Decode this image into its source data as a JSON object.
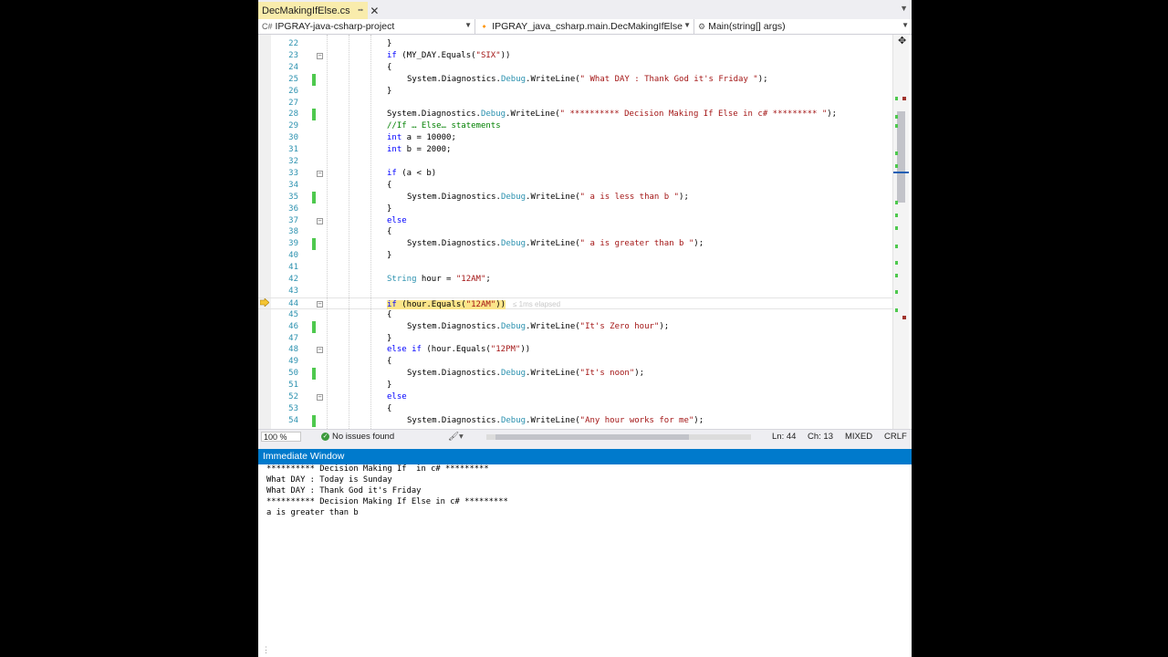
{
  "tab": {
    "filename": "DecMakingIfElse.cs",
    "pin_icon": "pin-icon",
    "close_icon": "close-icon"
  },
  "navbar": {
    "project": "IPGRAY-java-csharp-project",
    "class": "IPGRAY_java_csharp.main.DecMakingIfElse",
    "member": "Main(string[] args)"
  },
  "editor": {
    "current_line": 44,
    "elapsed_hint": "≤ 1ms elapsed",
    "lines": [
      {
        "n": "22",
        "segs": [
          [
            "",
            "}"
          ]
        ],
        "indent": 1
      },
      {
        "n": "23",
        "segs": [
          [
            "kw",
            "if"
          ],
          [
            "",
            " (MY_DAY.Equals("
          ],
          [
            "str",
            "\"SIX\""
          ],
          [
            "",
            "))"
          ]
        ],
        "indent": 1,
        "fold": true
      },
      {
        "n": "24",
        "segs": [
          [
            "",
            "{"
          ]
        ],
        "indent": 1
      },
      {
        "n": "25",
        "segs": [
          [
            "",
            "System.Diagnostics."
          ],
          [
            "cls",
            "Debug"
          ],
          [
            "",
            ".WriteLine("
          ],
          [
            "str",
            "\" What DAY : Thank God it's Friday \""
          ],
          [
            "",
            ");"
          ]
        ],
        "indent": 2,
        "chg": true
      },
      {
        "n": "26",
        "segs": [
          [
            "",
            "}"
          ]
        ],
        "indent": 1
      },
      {
        "n": "27",
        "segs": [],
        "indent": 1
      },
      {
        "n": "28",
        "segs": [
          [
            "",
            "System.Diagnostics."
          ],
          [
            "cls",
            "Debug"
          ],
          [
            "",
            ".WriteLine("
          ],
          [
            "str",
            "\" ********** Decision Making If Else in c# ********* \""
          ],
          [
            "",
            ");"
          ]
        ],
        "indent": 1,
        "chg": true
      },
      {
        "n": "29",
        "segs": [
          [
            "cmt",
            "//If … Else… statements"
          ]
        ],
        "indent": 1
      },
      {
        "n": "30",
        "segs": [
          [
            "kw",
            "int"
          ],
          [
            "",
            " a = 10000;"
          ]
        ],
        "indent": 1
      },
      {
        "n": "31",
        "segs": [
          [
            "kw",
            "int"
          ],
          [
            "",
            " b = 2000;"
          ]
        ],
        "indent": 1
      },
      {
        "n": "32",
        "segs": [],
        "indent": 1
      },
      {
        "n": "33",
        "segs": [
          [
            "kw",
            "if"
          ],
          [
            "",
            " (a < b)"
          ]
        ],
        "indent": 1,
        "fold": true
      },
      {
        "n": "34",
        "segs": [
          [
            "",
            "{"
          ]
        ],
        "indent": 1
      },
      {
        "n": "35",
        "segs": [
          [
            "",
            "System.Diagnostics."
          ],
          [
            "cls",
            "Debug"
          ],
          [
            "",
            ".WriteLine("
          ],
          [
            "str",
            "\" a is less than b \""
          ],
          [
            "",
            ");"
          ]
        ],
        "indent": 2,
        "chg": true
      },
      {
        "n": "36",
        "segs": [
          [
            "",
            "}"
          ]
        ],
        "indent": 1
      },
      {
        "n": "37",
        "segs": [
          [
            "kw",
            "else"
          ]
        ],
        "indent": 1,
        "fold": true
      },
      {
        "n": "38",
        "segs": [
          [
            "",
            "{"
          ]
        ],
        "indent": 1
      },
      {
        "n": "39",
        "segs": [
          [
            "",
            "System.Diagnostics."
          ],
          [
            "cls",
            "Debug"
          ],
          [
            "",
            ".WriteLine("
          ],
          [
            "str",
            "\" a is greater than b \""
          ],
          [
            "",
            ");"
          ]
        ],
        "indent": 2,
        "chg": true
      },
      {
        "n": "40",
        "segs": [
          [
            "",
            "}"
          ]
        ],
        "indent": 1
      },
      {
        "n": "41",
        "segs": [],
        "indent": 1
      },
      {
        "n": "42",
        "segs": [
          [
            "typ",
            "String"
          ],
          [
            "",
            " hour = "
          ],
          [
            "str",
            "\"12AM\""
          ],
          [
            "",
            ";"
          ]
        ],
        "indent": 1
      },
      {
        "n": "43",
        "segs": [],
        "indent": 1
      },
      {
        "n": "44",
        "segs": [
          [
            "hlkw",
            "if"
          ],
          [
            "hl",
            " (hour.Equals("
          ],
          [
            "hlstr",
            "\"12AM\""
          ],
          [
            "hl",
            "))"
          ]
        ],
        "indent": 1,
        "fold": true,
        "current": true
      },
      {
        "n": "45",
        "segs": [
          [
            "",
            "{"
          ]
        ],
        "indent": 1
      },
      {
        "n": "46",
        "segs": [
          [
            "",
            "System.Diagnostics."
          ],
          [
            "cls",
            "Debug"
          ],
          [
            "",
            ".WriteLine("
          ],
          [
            "str",
            "\"It's Zero hour\""
          ],
          [
            "",
            ");"
          ]
        ],
        "indent": 2,
        "chg": true
      },
      {
        "n": "47",
        "segs": [
          [
            "",
            "}"
          ]
        ],
        "indent": 1
      },
      {
        "n": "48",
        "segs": [
          [
            "kw",
            "else if"
          ],
          [
            "",
            " (hour.Equals("
          ],
          [
            "str",
            "\"12PM\""
          ],
          [
            "",
            "))"
          ]
        ],
        "indent": 1,
        "fold": true
      },
      {
        "n": "49",
        "segs": [
          [
            "",
            "{"
          ]
        ],
        "indent": 1
      },
      {
        "n": "50",
        "segs": [
          [
            "",
            "System.Diagnostics."
          ],
          [
            "cls",
            "Debug"
          ],
          [
            "",
            ".WriteLine("
          ],
          [
            "str",
            "\"It's noon\""
          ],
          [
            "",
            ");"
          ]
        ],
        "indent": 2,
        "chg": true
      },
      {
        "n": "51",
        "segs": [
          [
            "",
            "}"
          ]
        ],
        "indent": 1
      },
      {
        "n": "52",
        "segs": [
          [
            "kw",
            "else"
          ]
        ],
        "indent": 1,
        "fold": true
      },
      {
        "n": "53",
        "segs": [
          [
            "",
            "{"
          ]
        ],
        "indent": 1
      },
      {
        "n": "54",
        "segs": [
          [
            "",
            "System.Diagnostics."
          ],
          [
            "cls",
            "Debug"
          ],
          [
            "",
            ".WriteLine("
          ],
          [
            "str",
            "\"Any hour works for me\""
          ],
          [
            "",
            ");"
          ]
        ],
        "indent": 2,
        "chg": true
      }
    ]
  },
  "status": {
    "zoom": "100 %",
    "issues": "No issues found",
    "line": "Ln: 44",
    "col": "Ch: 13",
    "encoding": "MIXED",
    "eol": "CRLF"
  },
  "immediate": {
    "title": "Immediate Window",
    "lines": [
      "********** Decision Making If  in c# *********",
      "What DAY : Today is Sunday",
      "What DAY : Thank God it's Friday",
      "********** Decision Making If Else in c# *********",
      "a is greater than b"
    ]
  },
  "colors": {
    "accent": "#007acc",
    "tab_active": "#f9ecac",
    "change_bar": "#4ec94e",
    "keyword": "#0000ff",
    "string": "#a31515",
    "type": "#2b91af"
  }
}
